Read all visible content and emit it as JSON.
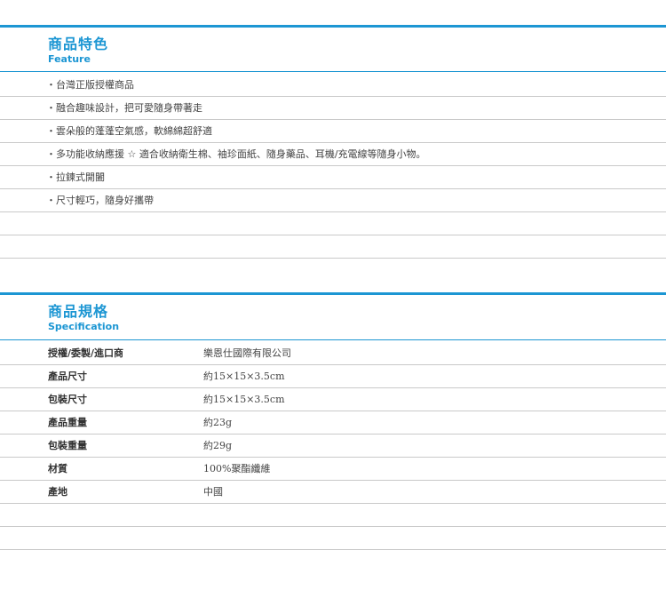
{
  "colors": {
    "accent": "#1c96d3",
    "rule": "#c9c9c9"
  },
  "feature": {
    "title": "商品特色",
    "subtitle": "Feature",
    "items": [
      "・台灣正版授權商品",
      "・融合趣味設計，把可愛隨身帶著走",
      "・雲朵般的蓬蓬空氣感，軟綿綿超舒適",
      "・多功能收納應援 ☆ 適合收納衛生棉、袖珍面紙、隨身藥品、耳機/充電線等隨身小物。",
      "・拉鍊式開闔",
      "・尺寸輕巧，隨身好攜帶",
      "",
      "",
      ""
    ]
  },
  "specification": {
    "title": "商品規格",
    "subtitle": "Specification",
    "rows": [
      {
        "label": "授權/委製/進口商",
        "value": "樂恩仕國際有限公司"
      },
      {
        "label": "產品尺寸",
        "value": "約15×15×3.5cm"
      },
      {
        "label": "包裝尺寸",
        "value": "約15×15×3.5cm"
      },
      {
        "label": "產品重量",
        "value": "約23g"
      },
      {
        "label": "包裝重量",
        "value": "約29g"
      },
      {
        "label": "材質",
        "value": "100%聚酯纖維"
      },
      {
        "label": "產地",
        "value": "中國"
      },
      {
        "label": "",
        "value": ""
      },
      {
        "label": "",
        "value": ""
      }
    ]
  }
}
